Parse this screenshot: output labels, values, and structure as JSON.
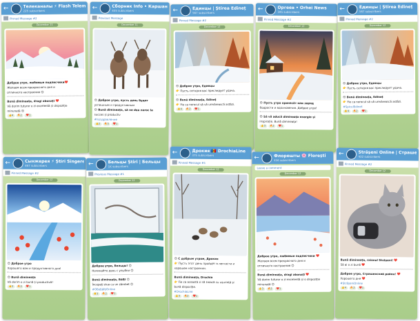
{
  "cards": [
    {
      "title": "Телеканалы ⚡ Flash Telem",
      "subtitle": "225 subscribers",
      "pinned": "Pinned Message #2",
      "date": "December 11",
      "lines": [
        "Доброе утро, любимые подписчики❤️",
        "Желаем всем прекрасного дня и",
        "отличного настроения 😊",
        "Bună dimineața, dragi abonați ❤️",
        "Vă dorim tuturor o zi excelentă și dispoziție",
        "minunată 😊"
      ],
      "reactions": [
        "👍4",
        "🔥2",
        "❤️1"
      ]
    },
    {
      "title": "Сборник Info • Каршани",
      "subtitle": "435 subscribers",
      "pinned": "Previous Message",
      "date": "December 11",
      "lines": [
        "😊 Доброе утро, пусть день будет",
        "успешным и продуктивным",
        "😊 Bună dimineața, să ne dea noroc la",
        "succes și productiv",
        "#поздравление"
      ],
      "reactions": [
        "👍2",
        "🔥3",
        "❤️1"
      ]
    },
    {
      "title": "Единцы | Știrea Edineț",
      "subtitle": "567 subscribers",
      "pinned": "Pinned Message #2",
      "date": "December 12",
      "lines": [
        "😊 Доброе утро, Единцы",
        "👉 Пусть сегодня вас преследует удача.",
        "😊 Bună dimineața, Edineț",
        "👉 Fie ca norocul să vă urmărească astăzi."
      ],
      "reactions": [
        "👍4",
        "🔥2",
        "❤️1"
      ]
    },
    {
      "title": "Оргеев • Orhei News",
      "subtitle": "345 subscribers",
      "pinned": "Pinned Message #2",
      "date": "December 12",
      "lines": [
        "😊 Пусть утро принесёт вам заряд",
        "бодрости и вдохновения. Доброе утро!",
        "😊 Să vă aducă dimineața energie și",
        "inspirație. Bună dimineața!"
      ],
      "reactions": [
        "👍3",
        "🔥2",
        "❤️1"
      ]
    },
    {
      "title": "Единцы | Știrea Edineț",
      "subtitle": "567 subscribers",
      "pinned": "Pinned Message #2",
      "date": "December 12",
      "lines": [
        "😊 Доброе утро, Единцы",
        "👉 Пусть сегодня вас преследует удача.",
        "😊 Bună dimineața, Edineț",
        "👉 Fie ca norocul să vă urmărească astăzi.",
        "#SpiculEdinet"
      ],
      "reactions": [
        "👍4",
        "🔥2",
        "❤️1"
      ]
    },
    {
      "title": "Сынжерея ⚡ Știri Sîngerei",
      "subtitle": "467 subscribers",
      "pinned": "Pinned Message #2",
      "date": "December 12",
      "lines": [
        "😊 Доброе утро",
        "Хорошего вам и продуктивного дня!",
        "😊 Bună dimineața",
        "Vă dorim o zi bună și productivă!"
      ],
      "reactions": [
        "👍3",
        "🔥2",
        "❤️1"
      ]
    },
    {
      "title": "Бельцы Știri | Бельцы",
      "subtitle": "1K subscribers",
      "pinned": "Previous Message #1",
      "date": "December 12",
      "lines": [
        "Доброе утро, Бельцы! 😊",
        "Начинайте день с улыбки 😊",
        "Bună dimineața, Bălți 😊",
        "Începeți ziua cu un zâmbet 😊",
        "#ОбоБălțiOnline"
      ],
      "reactions": [
        "👍3",
        "🔥2",
        "❤️1"
      ]
    },
    {
      "title": "Дрокия 🇲🇩 DrochiaLine",
      "subtitle": "375 subscribers",
      "pinned": "Pinned Message #1",
      "date": "December 12",
      "lines": [
        "😊 С добрым утром, Дрокия",
        "👉 Пусть этот день пройдёт в легкости и",
        "хорошем настроении.",
        "Bună dimineața, Drochia",
        "👉 Fie ca această zi să treacă cu ușurință și",
        "bună dispoziție.",
        "#DrochiaLine"
      ],
      "reactions": [
        "👍3",
        "🔥2",
        "❤️1"
      ]
    },
    {
      "title": "Флорешты 🌸 Florești",
      "subtitle": "456 subscribers",
      "pinned": "Leave a comment",
      "date": "December 12",
      "lines": [
        "Доброе утро, любимые подписчики ❤️",
        "Желаем всем прекрасного дня и",
        "отличного настроения 😊",
        "Bună dimineața, dragi abonați ❤️",
        "Vă dorim tuturor o zi excelentă și o dispoziție",
        "minunată 😊"
      ],
      "reactions": [
        "👍3",
        "🔥2",
        "❤️1"
      ]
    },
    {
      "title": "Străşeni Online | Страшены",
      "subtitle": "432 subscribers",
      "pinned": "Pinned Message #2",
      "date": "December 12",
      "lines": [
        "Bună dimineața, raionul Strășeni! ❤️",
        "Să ai o zi bună ❤️",
        "Доброе утро, Страшенский район! ❤️",
        "Хорошего дня ❤️",
        "#StrășeniOnline"
      ],
      "reactions": [
        "👍4",
        "🔥2",
        "❤️1"
      ]
    }
  ]
}
